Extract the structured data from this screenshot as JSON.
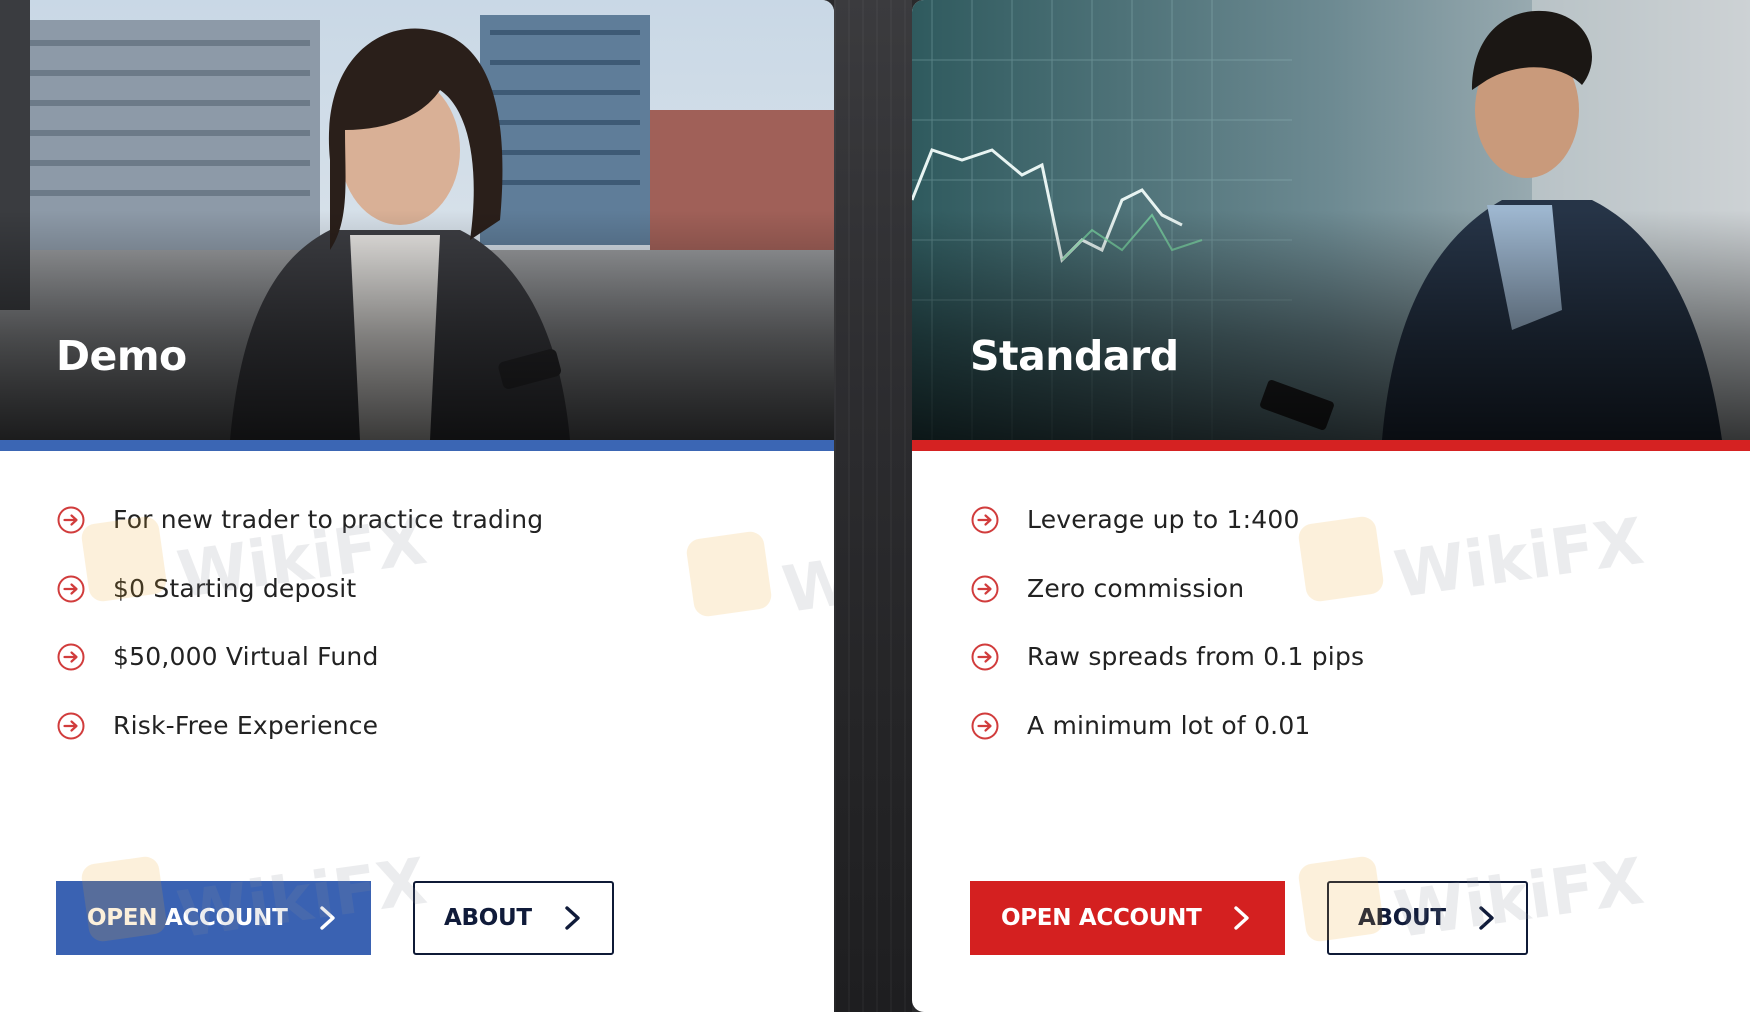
{
  "accounts": {
    "demo": {
      "title": "Demo",
      "features": [
        "For new trader to practice trading",
        "$0 Starting deposit",
        "$50,000 Virtual Fund",
        "Risk-Free Experience"
      ],
      "open_label": "OPEN ACCOUNT",
      "about_label": "ABOUT",
      "accent_color": "#3b66b4"
    },
    "standard": {
      "title": "Standard",
      "features": [
        "Leverage up to 1:400",
        "Zero commission",
        "Raw spreads from 0.1 pips",
        "A minimum lot of 0.01"
      ],
      "open_label": "OPEN ACCOUNT",
      "about_label": "ABOUT",
      "accent_color": "#d52222"
    }
  },
  "watermark": {
    "text": "WikiFX"
  },
  "icons": {
    "bullet": "circle-arrow-right-icon",
    "button": "chevron-right-icon"
  }
}
